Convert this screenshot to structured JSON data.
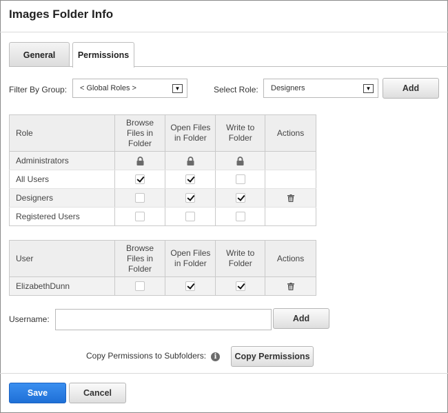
{
  "title": "Images Folder Info",
  "tabs": [
    {
      "label": "General",
      "active": false
    },
    {
      "label": "Permissions",
      "active": true
    }
  ],
  "filter": {
    "group_label": "Filter By Group:",
    "group_value": "< Global Roles >",
    "role_label": "Select Role:",
    "role_value": "Designers",
    "add_label": "Add"
  },
  "roles_table": {
    "headers": [
      "Role",
      "Browse Files in Folder",
      "Open Files in Folder",
      "Write to Folder",
      "Actions"
    ],
    "rows": [
      {
        "name": "Administrators",
        "browse": "locked",
        "open": "locked",
        "write": "locked",
        "delete": false
      },
      {
        "name": "All Users",
        "browse": true,
        "open": true,
        "write": false,
        "delete": false
      },
      {
        "name": "Designers",
        "browse": false,
        "open": true,
        "write": true,
        "delete": true
      },
      {
        "name": "Registered Users",
        "browse": false,
        "open": false,
        "write": false,
        "delete": false
      }
    ]
  },
  "users_table": {
    "headers": [
      "User",
      "Browse Files in Folder",
      "Open Files in Folder",
      "Write to Folder",
      "Actions"
    ],
    "rows": [
      {
        "name": "ElizabethDunn",
        "browse": false,
        "open": true,
        "write": true,
        "delete": true
      }
    ]
  },
  "username": {
    "label": "Username:",
    "value": "",
    "add_label": "Add"
  },
  "copy": {
    "label": "Copy Permissions to Subfolders:",
    "info_glyph": "i",
    "button_label": "Copy Permissions"
  },
  "footer": {
    "save_label": "Save",
    "cancel_label": "Cancel"
  },
  "colors": {
    "save_button": "#2a7de6",
    "header_bg": "#eeeeee"
  }
}
